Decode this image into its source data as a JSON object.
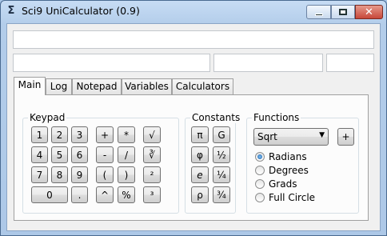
{
  "window": {
    "title": "Sci9 UniCalculator (0.9)",
    "icon": "sigma-app-icon",
    "controls": {
      "minimize": "",
      "maximize": "",
      "close": "✕"
    }
  },
  "display": {
    "main_value": "",
    "field_a": "",
    "field_b": "",
    "field_c": ""
  },
  "tabs": [
    {
      "label": "Main",
      "active": true
    },
    {
      "label": "Log",
      "active": false
    },
    {
      "label": "Notepad",
      "active": false
    },
    {
      "label": "Variables",
      "active": false
    },
    {
      "label": "Calculators",
      "active": false
    }
  ],
  "keypad": {
    "title": "Keypad",
    "digits": [
      "1",
      "2",
      "3",
      "4",
      "5",
      "6",
      "7",
      "8",
      "9",
      "0",
      "."
    ],
    "operators": [
      "+",
      "*",
      "-",
      "/",
      "(",
      ")",
      "^",
      "%"
    ],
    "functions": [
      "√",
      "∛",
      "²",
      "³"
    ]
  },
  "constants": {
    "title": "Constants",
    "items": [
      "π",
      "G",
      "φ",
      "½",
      "e",
      "¼",
      "ρ",
      "¾"
    ]
  },
  "functions": {
    "title": "Functions",
    "selected": "Sqrt",
    "add_label": "+",
    "angle_modes": [
      {
        "label": "Radians",
        "checked": true
      },
      {
        "label": "Degrees",
        "checked": false
      },
      {
        "label": "Grads",
        "checked": false
      },
      {
        "label": "Full Circle",
        "checked": false
      }
    ]
  }
}
